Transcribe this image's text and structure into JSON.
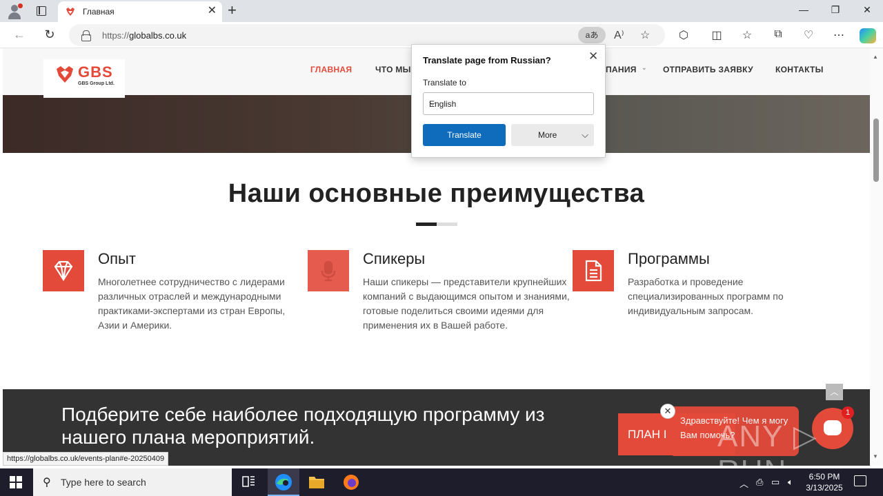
{
  "browser": {
    "tab_title": "Главная",
    "url_scheme": "https://",
    "url_host": "globalbs.co.uk",
    "translate_icon_text": "aあ",
    "new_tab": "+",
    "close_tab": "✕",
    "status_url": "https://globalbs.co.uk/events-plan#e-20250409"
  },
  "translate_popup": {
    "title": "Translate page from Russian?",
    "label": "Translate to",
    "selected_language": "English",
    "translate_button": "Translate",
    "more_button": "More"
  },
  "site": {
    "logo_brand": "GBS",
    "logo_sub": "GBS Group Ltd.",
    "nav": [
      {
        "label": "ГЛАВНАЯ"
      },
      {
        "label": "ЧТО МЫ"
      },
      {
        "label": "ПАНИЯ"
      },
      {
        "label": "ОТПРАВИТЬ ЗАЯВКУ"
      },
      {
        "label": "КОНТАКТЫ"
      }
    ],
    "section_title": "Наши основные преимущества",
    "features": [
      {
        "title": "Опыт",
        "text": "Многолетнее сотрудничество с лидерами различных отраслей и международными практиками-экспертами из стран Европы, Азии и Америки.",
        "icon": "diamond-icon"
      },
      {
        "title": "Спикеры",
        "text": "Наши спикеры — представители крупнейших компаний с выдающимся опытом и знаниями, готовые поделиться своими идеями для применения их в Вашей работе.",
        "icon": "microphone-icon"
      },
      {
        "title": "Программы",
        "text": "Разработка и проведение специализированных программ по индивидуальным запросам.",
        "icon": "document-icon"
      }
    ],
    "banner_text": "Подберите себе наиболее подходящую программу из нашего плана мероприятий.",
    "banner_button": "ПЛАН I",
    "chat_message": "Здравствуйте! Чем я могу Вам помочь?",
    "chat_badge": "1",
    "watermark": "ANY ▷ RUN"
  },
  "taskbar": {
    "search_placeholder": "Type here to search",
    "time": "6:50 PM",
    "date": "3/13/2025"
  },
  "colors": {
    "accent": "#e34a3a",
    "translate_blue": "#0f6cbd",
    "taskbar": "#1d1d2b"
  }
}
